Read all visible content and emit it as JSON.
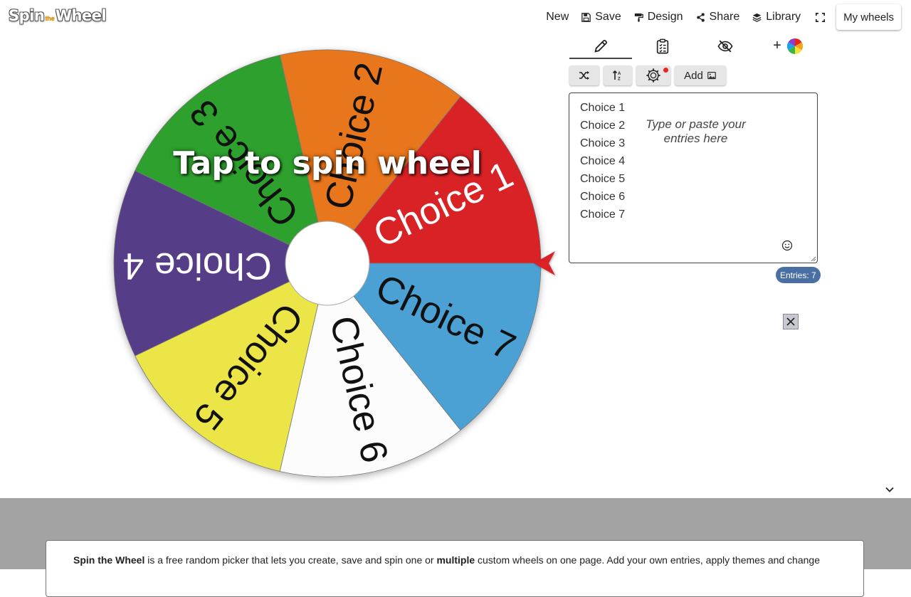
{
  "app": {
    "logo": {
      "part1": "Spin",
      "part2": "the",
      "part3": "Wheel"
    }
  },
  "topnav": {
    "new_label": "New",
    "save_label": "Save",
    "design_label": "Design",
    "share_label": "Share",
    "library_label": "Library",
    "my_wheels_label": "My wheels"
  },
  "wheel": {
    "overlay_text": "Tap to spin wheel",
    "colors": {
      "accent_pointer": "#d92228"
    },
    "segments": [
      {
        "label": "Choice 1",
        "color": "#d92228",
        "text_color": "#ffffff"
      },
      {
        "label": "Choice 2",
        "color": "#e8761b",
        "text_color": "#111111"
      },
      {
        "label": "Choice 3",
        "color": "#2ea02e",
        "text_color": "#111111"
      },
      {
        "label": "Choice 4",
        "color": "#573d87",
        "text_color": "#ffffff"
      },
      {
        "label": "Choice 5",
        "color": "#ece547",
        "text_color": "#111111"
      },
      {
        "label": "Choice 6",
        "color": "#fcfcfc",
        "text_color": "#111111"
      },
      {
        "label": "Choice 7",
        "color": "#4ba1d4",
        "text_color": "#111111"
      }
    ]
  },
  "tabs": [
    {
      "icon": "pencil-icon",
      "active": true
    },
    {
      "icon": "clipboard-list-icon",
      "active": false
    },
    {
      "icon": "eye-slash-icon",
      "active": false
    },
    {
      "icon": "plus-icon",
      "active": false,
      "label": "+"
    }
  ],
  "toolbar": {
    "shuffle_icon": "shuffle-icon",
    "sort_icon": "sort-icon",
    "settings_icon": "gear-icon",
    "add_label": "Add"
  },
  "entries": {
    "items": [
      "Choice 1",
      "Choice 2",
      "Choice 3",
      "Choice 4",
      "Choice 5",
      "Choice 6",
      "Choice 7"
    ],
    "placeholder": "Type or paste your entries here",
    "count_label": "Entries: 7"
  },
  "footer": {
    "brand": "Spin the Wheel",
    "text_a": " is a free random picker that lets you create, save and spin one or ",
    "text_bold": "multiple",
    "text_b": " custom wheels on one page. Add your own entries, apply themes and change"
  }
}
